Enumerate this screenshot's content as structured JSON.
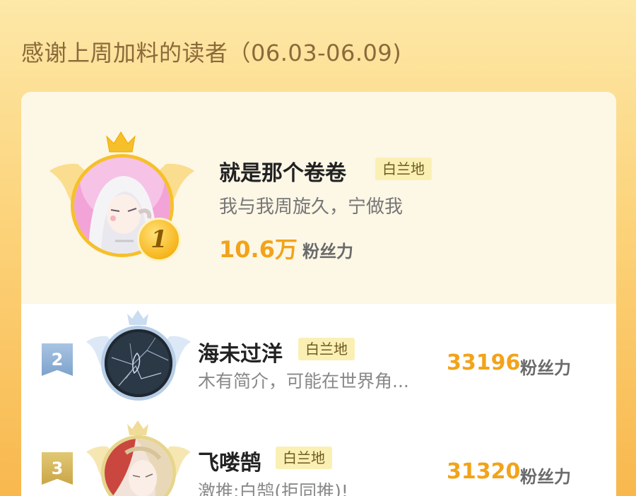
{
  "header": {
    "title": "感谢上周加料的读者（06.03-06.09)"
  },
  "readers": [
    {
      "rank": "1",
      "name": "就是那个卷卷",
      "tag": "白兰地",
      "bio": "我与我周旋久，宁做我",
      "fans_value": "10.6万",
      "fans_unit": "粉丝力"
    },
    {
      "rank": "2",
      "name": "海未过洋",
      "tag": "白兰地",
      "bio": "木有简介，可能在世界角...",
      "fans_value": "33196",
      "fans_unit": "粉丝力"
    },
    {
      "rank": "3",
      "name": "飞喽鹄",
      "tag": "白兰地",
      "bio": "激推:白鹄(拒同推)!",
      "fans_value": "31320",
      "fans_unit": "粉丝力"
    }
  ],
  "colors": {
    "accent": "#f2a31a",
    "rank2_badge": "#8fb2d8",
    "rank3_badge": "#d6b65c"
  }
}
